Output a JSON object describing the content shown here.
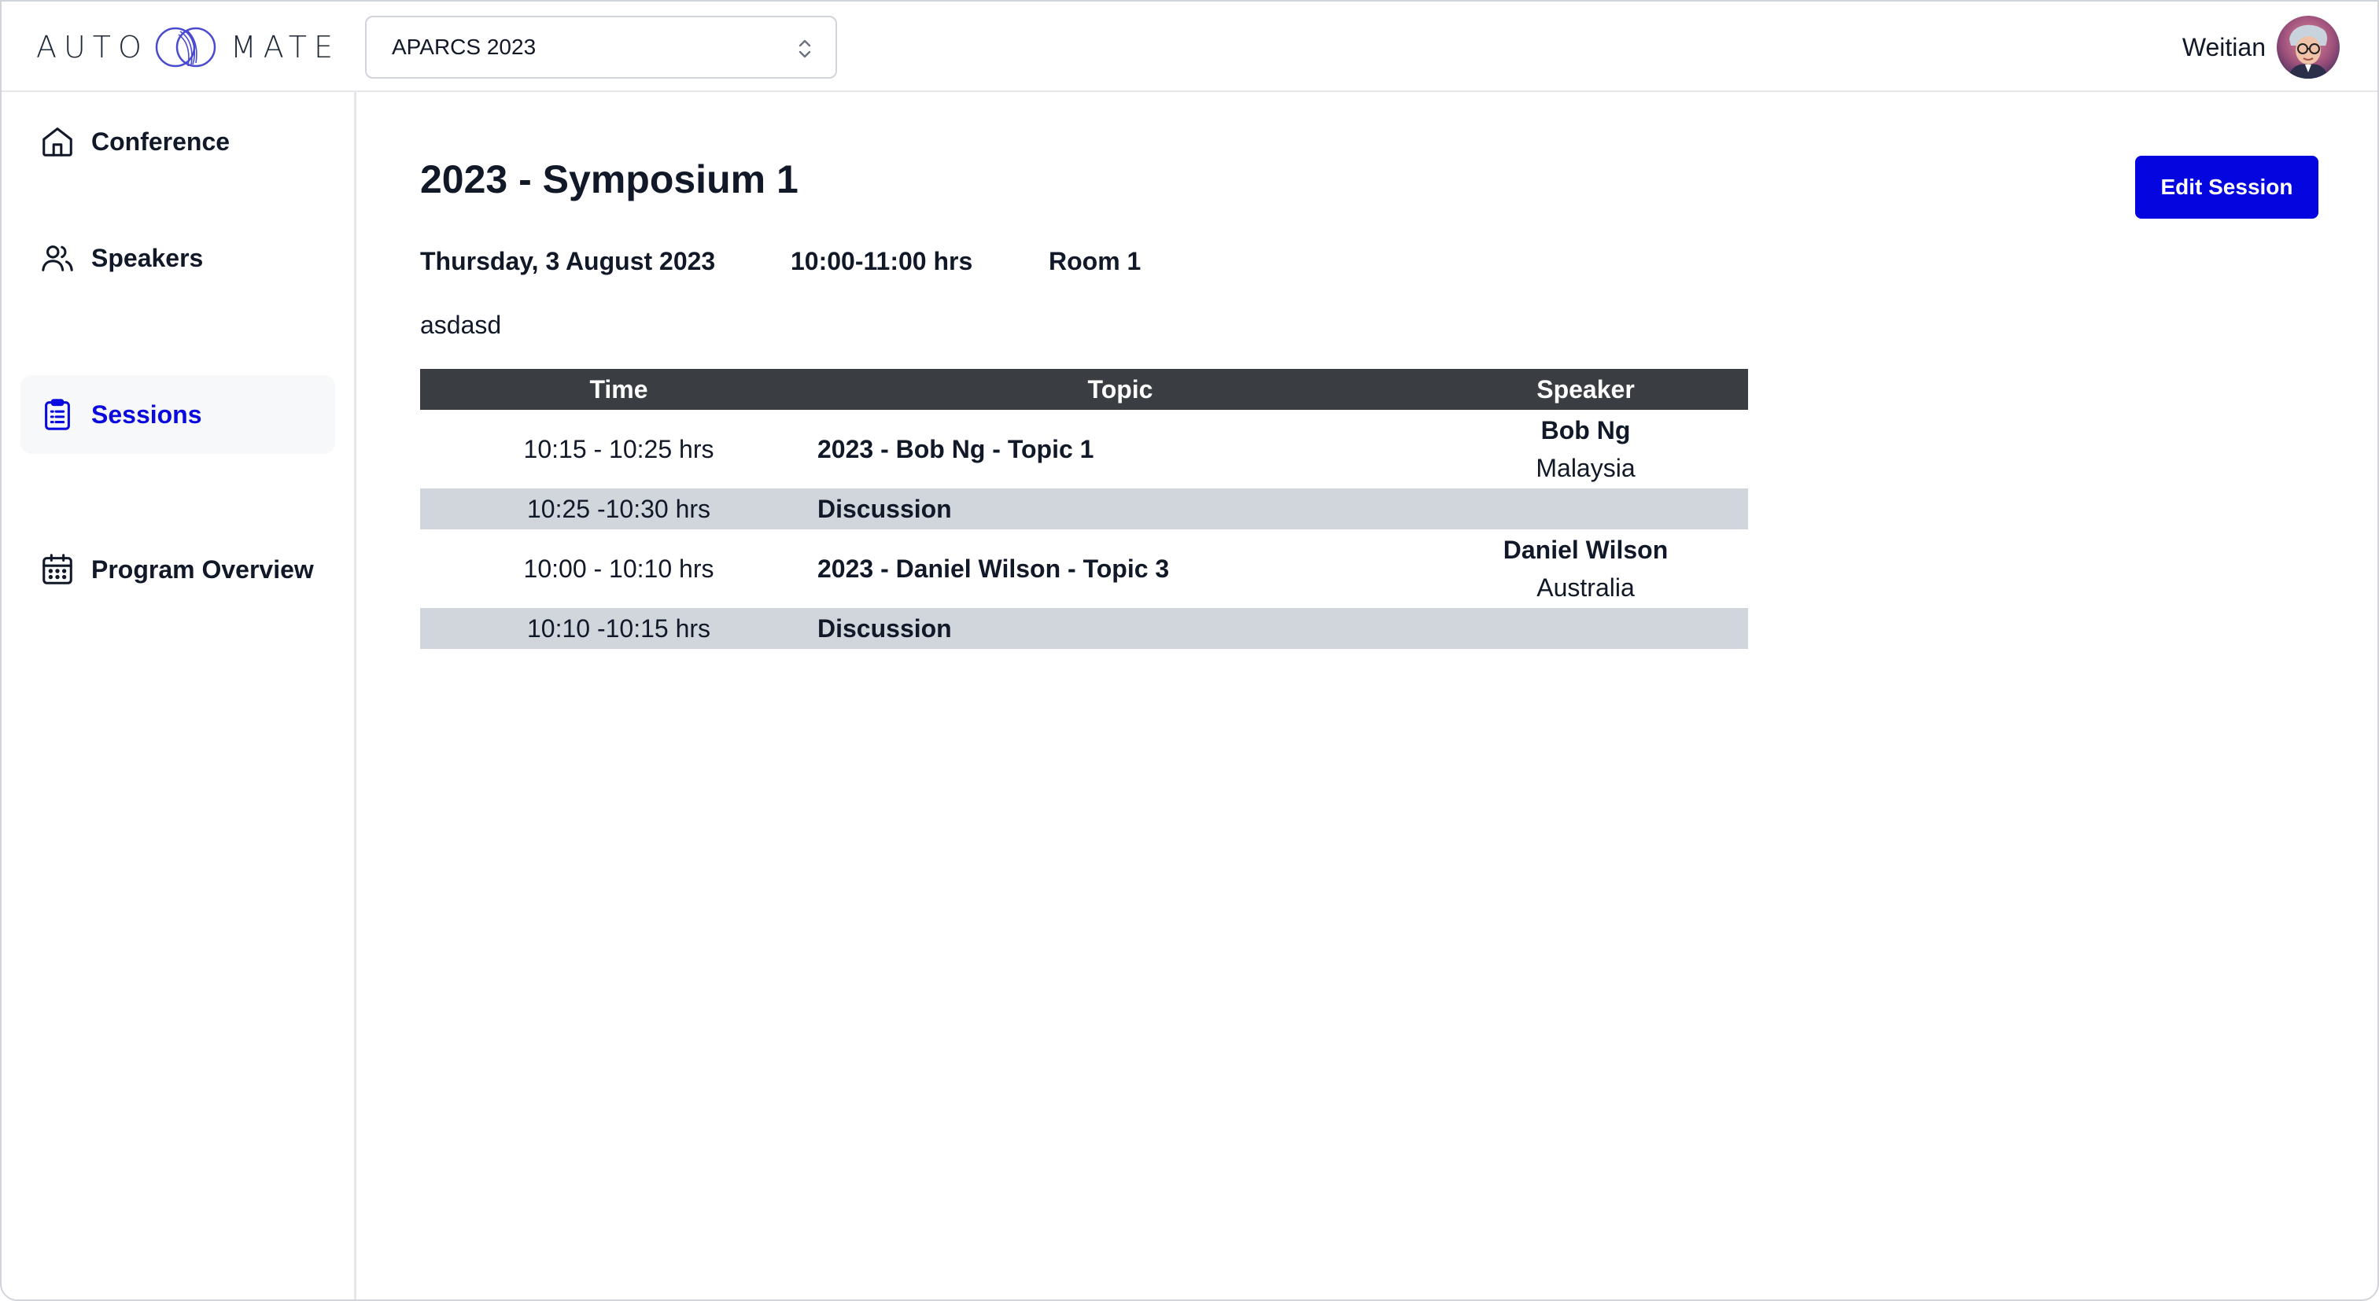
{
  "header": {
    "logo_left": "AUTO",
    "logo_right": "MATE",
    "conference_select": "APARCS 2023",
    "user_name": "Weitian"
  },
  "sidebar": {
    "items": [
      {
        "label": "Conference",
        "icon": "home-icon",
        "active": false
      },
      {
        "label": "Speakers",
        "icon": "users-icon",
        "active": false
      },
      {
        "label": "Sessions",
        "icon": "clipboard-list-icon",
        "active": true
      },
      {
        "label": "Program Overview",
        "icon": "calendar-icon",
        "active": false
      }
    ]
  },
  "session": {
    "title": "2023 - Symposium 1",
    "date": "Thursday, 3 August 2023",
    "time": "10:00-11:00 hrs",
    "room": "Room 1",
    "description": "asdasd",
    "edit_label": "Edit Session"
  },
  "table": {
    "headers": [
      "Time",
      "Topic",
      "Speaker"
    ],
    "rows": [
      {
        "time": "10:15 - 10:25 hrs",
        "topic": "2023 - Bob Ng - Topic 1",
        "speaker": "Bob Ng",
        "country": "Malaysia"
      },
      {
        "time": "10:25 -10:30 hrs",
        "topic": "Discussion",
        "speaker": "",
        "country": ""
      },
      {
        "time": "10:00 - 10:10 hrs",
        "topic": "2023 - Daniel Wilson - Topic 3",
        "speaker": "Daniel Wilson",
        "country": "Australia"
      },
      {
        "time": "10:10 -10:15 hrs",
        "topic": "Discussion",
        "speaker": "",
        "country": ""
      }
    ]
  },
  "colors": {
    "accent": "#0505e0",
    "active_nav_text": "#0a0adf",
    "table_header_bg": "#3a3e42",
    "discussion_row_bg": "#d1d6dd"
  }
}
